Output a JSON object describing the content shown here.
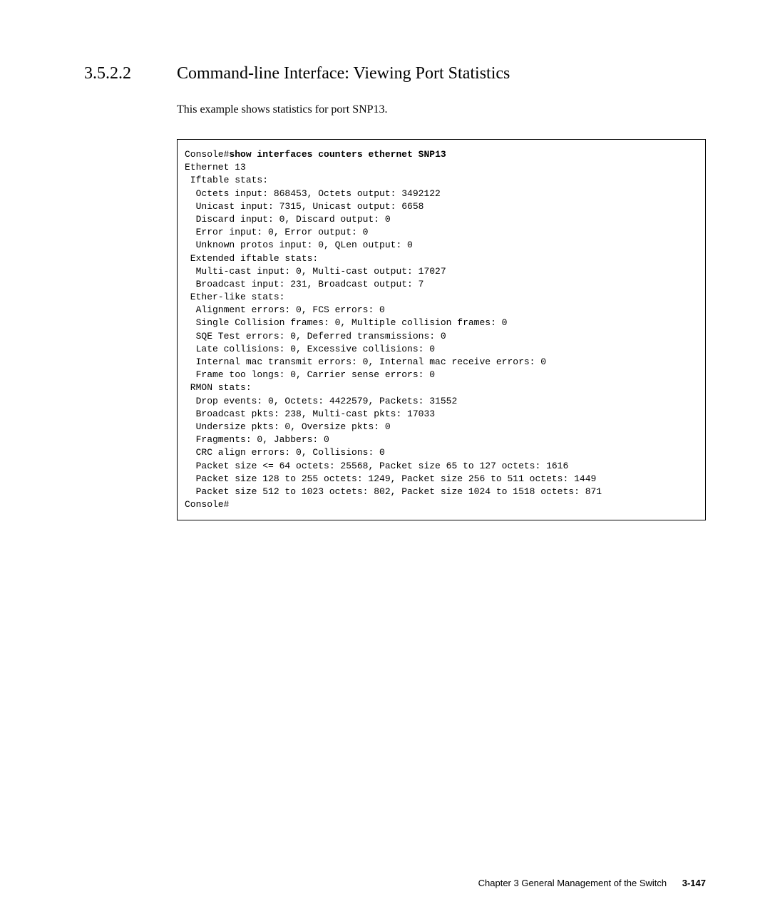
{
  "section": {
    "number": "3.5.2.2",
    "title": "Command-line Interface: Viewing Port Statistics",
    "intro": "This example shows statistics for port SNP13."
  },
  "console": {
    "prompt": "Console#",
    "command": "show interfaces counters ethernet SNP13",
    "lines": [
      "Ethernet 13",
      " Iftable stats:",
      "  Octets input: 868453, Octets output: 3492122",
      "  Unicast input: 7315, Unicast output: 6658",
      "  Discard input: 0, Discard output: 0",
      "  Error input: 0, Error output: 0",
      "  Unknown protos input: 0, QLen output: 0",
      " Extended iftable stats:",
      "  Multi-cast input: 0, Multi-cast output: 17027",
      "  Broadcast input: 231, Broadcast output: 7",
      " Ether-like stats:",
      "  Alignment errors: 0, FCS errors: 0",
      "  Single Collision frames: 0, Multiple collision frames: 0",
      "  SQE Test errors: 0, Deferred transmissions: 0",
      "  Late collisions: 0, Excessive collisions: 0",
      "  Internal mac transmit errors: 0, Internal mac receive errors: 0",
      "  Frame too longs: 0, Carrier sense errors: 0",
      " RMON stats:",
      "  Drop events: 0, Octets: 4422579, Packets: 31552",
      "  Broadcast pkts: 238, Multi-cast pkts: 17033",
      "  Undersize pkts: 0, Oversize pkts: 0",
      "  Fragments: 0, Jabbers: 0",
      "  CRC align errors: 0, Collisions: 0",
      "  Packet size <= 64 octets: 25568, Packet size 65 to 127 octets: 1616",
      "  Packet size 128 to 255 octets: 1249, Packet size 256 to 511 octets: 1449",
      "  Packet size 512 to 1023 octets: 802, Packet size 1024 to 1518 octets: 871",
      "Console#"
    ]
  },
  "footer": {
    "chapter": "Chapter 3   General Management of the Switch",
    "page": "3-147"
  }
}
